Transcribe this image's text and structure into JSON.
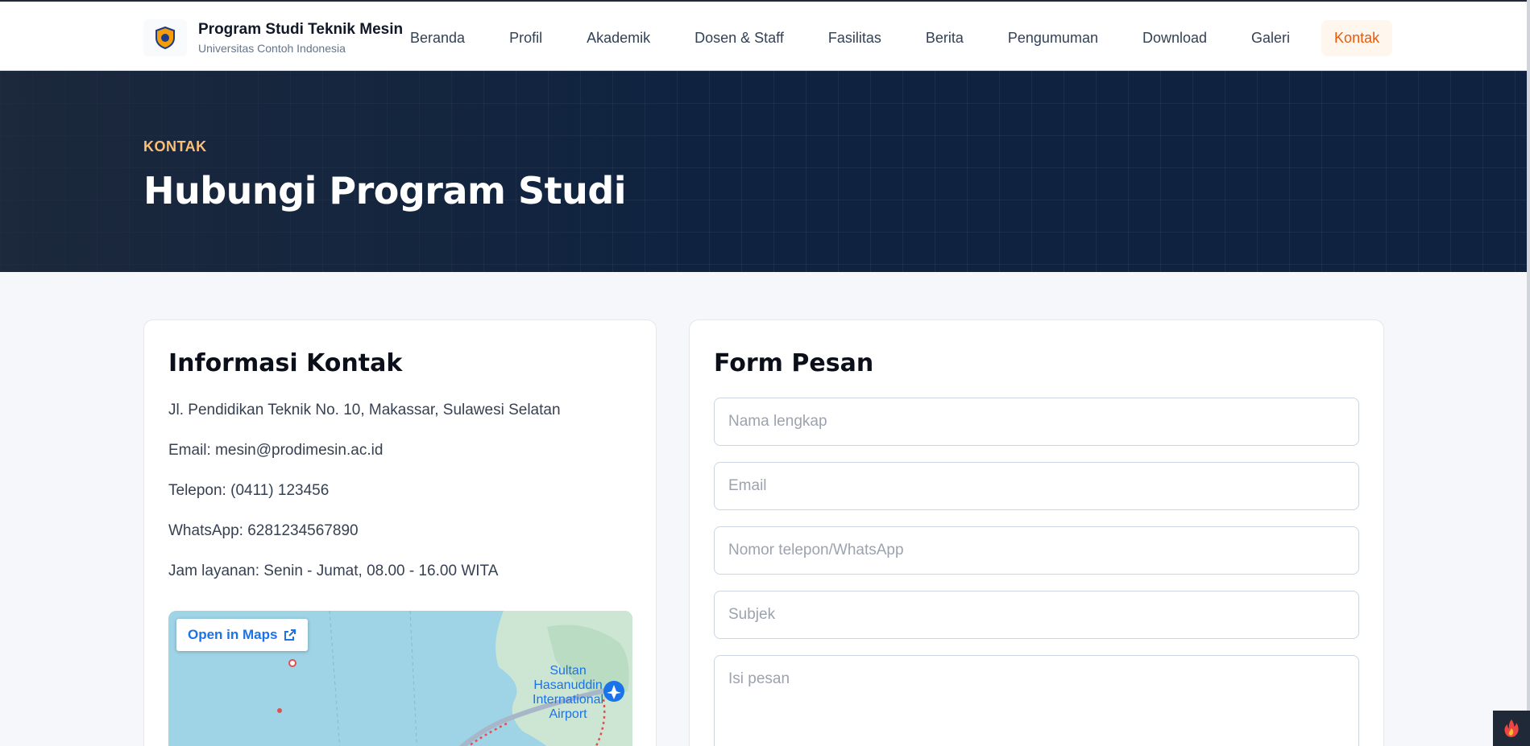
{
  "header": {
    "title": "Program Studi Teknik Mesin",
    "subtitle": "Universitas Contoh Indonesia",
    "logo_icon": "university-crest-icon",
    "nav": [
      {
        "label": "Beranda"
      },
      {
        "label": "Profil"
      },
      {
        "label": "Akademik"
      },
      {
        "label": "Dosen & Staff"
      },
      {
        "label": "Fasilitas"
      },
      {
        "label": "Berita"
      },
      {
        "label": "Pengumuman"
      },
      {
        "label": "Download"
      },
      {
        "label": "Galeri"
      },
      {
        "label": "Kontak",
        "active": true
      }
    ]
  },
  "hero": {
    "eyebrow": "KONTAK",
    "title": "Hubungi Program Studi"
  },
  "info": {
    "heading": "Informasi Kontak",
    "address": "Jl. Pendidikan Teknik No. 10, Makassar, Sulawesi Selatan",
    "email": "Email: mesin@prodimesin.ac.id",
    "phone": "Telepon: (0411) 123456",
    "whatsapp": "WhatsApp: 6281234567890",
    "hours": "Jam layanan: Senin - Jumat, 08.00 - 16.00 WITA",
    "map": {
      "open_label": "Open in Maps",
      "place_label_1": "Sultan",
      "place_label_2": "Hasanuddin",
      "place_label_3": "International",
      "place_label_4": "Airport"
    }
  },
  "form": {
    "heading": "Form Pesan",
    "name_placeholder": "Nama lengkap",
    "email_placeholder": "Email",
    "phone_placeholder": "Nomor telepon/WhatsApp",
    "subject_placeholder": "Subjek",
    "message_placeholder": "Isi pesan"
  },
  "colors": {
    "accent": "#ea580c",
    "hero_bg": "#0f2340",
    "eyebrow": "#fbbf77"
  }
}
